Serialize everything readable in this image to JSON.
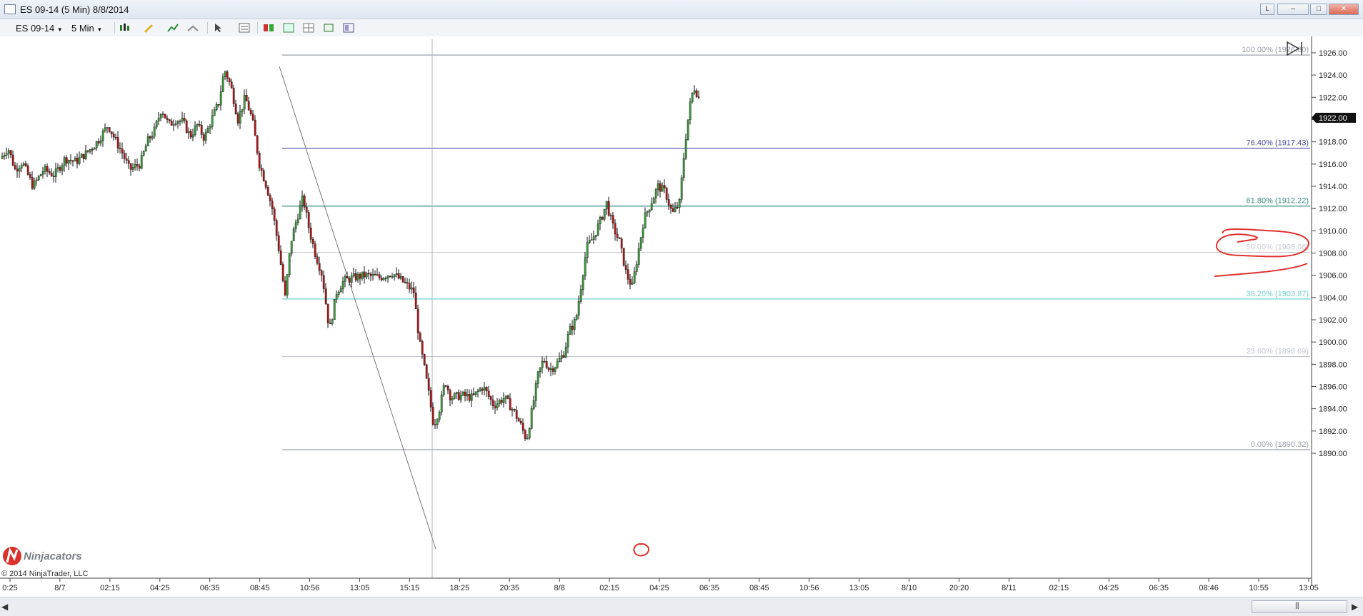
{
  "window": {
    "title": "ES 09-14 (5 Min)  8/8/2014",
    "btn_l": "L"
  },
  "toolbar": {
    "instrument": "ES 09-14",
    "interval": "5 Min"
  },
  "axis": {
    "y_labels": [
      "1926.00",
      "1924.00",
      "1922.00",
      "1920.00",
      "1918.00",
      "1916.00",
      "1914.00",
      "1912.00",
      "1910.00",
      "1908.00",
      "1906.00",
      "1904.00",
      "1902.00",
      "1900.00",
      "1898.00",
      "1896.00",
      "1894.00",
      "1892.00",
      "1890.00"
    ],
    "x_labels": [
      "0:25",
      "8/7",
      "02:15",
      "04:25",
      "06:35",
      "08:45",
      "10:56",
      "13:05",
      "15:15",
      "18:25",
      "20:35",
      "8/8",
      "02:15",
      "04:25",
      "06:35",
      "08:45",
      "10:56",
      "13:05",
      "8/10",
      "20:20",
      "8/11",
      "02:15",
      "04:25",
      "06:35",
      "08:46",
      "10:55",
      "13:05"
    ]
  },
  "fib_levels": [
    {
      "label": "100.00% (1926.80)",
      "price": 1925.8,
      "color": "#9aa0a8"
    },
    {
      "label": "76.40% (1917.43)",
      "price": 1917.43,
      "color": "#4c4c9e"
    },
    {
      "label": "61.80% (1912.22)",
      "price": 1912.22,
      "color": "#3a8a86"
    },
    {
      "label": "50.00% (1908.06)",
      "price": 1908.06,
      "color": "#c9ccd1"
    },
    {
      "label": "38.20% (1903.87)",
      "price": 1903.87,
      "color": "#6fd2cc"
    },
    {
      "label": "23.60% (1898.69)",
      "price": 1898.69,
      "color": "#c3c6cc"
    },
    {
      "label": "0.00% (1890.32)",
      "price": 1890.32,
      "color": "#9aa0a8"
    }
  ],
  "current_price": "1922.00",
  "branding": {
    "logo": "Ninjacators",
    "copyright": "© 2014 NinjaTrader, LLC"
  },
  "price_path": [
    [
      0,
      1916.5
    ],
    [
      10,
      1917.5
    ],
    [
      20,
      1915.5
    ],
    [
      30,
      1916.2
    ],
    [
      45,
      1914
    ],
    [
      60,
      1915.5
    ],
    [
      75,
      1915
    ],
    [
      90,
      1916.5
    ],
    [
      105,
      1916.2
    ],
    [
      120,
      1917
    ],
    [
      135,
      1918
    ],
    [
      150,
      1919.5
    ],
    [
      160,
      1918.2
    ],
    [
      170,
      1917
    ],
    [
      180,
      1915.5
    ],
    [
      195,
      1916
    ],
    [
      205,
      1918
    ],
    [
      215,
      1919
    ],
    [
      225,
      1921
    ],
    [
      235,
      1919.5
    ],
    [
      245,
      1920
    ],
    [
      255,
      1919.8
    ],
    [
      265,
      1918.5
    ],
    [
      275,
      1919.5
    ],
    [
      285,
      1918.3
    ],
    [
      295,
      1920
    ],
    [
      305,
      1921.5
    ],
    [
      313,
      1924.5
    ],
    [
      322,
      1923
    ],
    [
      332,
      1920
    ],
    [
      342,
      1922
    ],
    [
      352,
      1920
    ],
    [
      362,
      1916
    ],
    [
      372,
      1914
    ],
    [
      380,
      1912
    ],
    [
      390,
      1908
    ],
    [
      398,
      1904
    ],
    [
      406,
      1909
    ],
    [
      414,
      1911
    ],
    [
      423,
      1913
    ],
    [
      432,
      1910
    ],
    [
      440,
      1908
    ],
    [
      450,
      1906
    ],
    [
      460,
      1901
    ],
    [
      470,
      1904.5
    ],
    [
      480,
      1905.5
    ],
    [
      495,
      1905.8
    ],
    [
      510,
      1906
    ],
    [
      530,
      1905.8
    ],
    [
      548,
      1906.2
    ],
    [
      565,
      1905.3
    ],
    [
      578,
      1904.5
    ],
    [
      586,
      1900
    ],
    [
      592,
      1898
    ],
    [
      600,
      1895
    ],
    [
      606,
      1892.5
    ],
    [
      614,
      1894
    ],
    [
      622,
      1896.5
    ],
    [
      630,
      1895
    ],
    [
      645,
      1895.2
    ],
    [
      660,
      1895
    ],
    [
      675,
      1896
    ],
    [
      690,
      1894.3
    ],
    [
      705,
      1895
    ],
    [
      718,
      1893.8
    ],
    [
      728,
      1892.5
    ],
    [
      736,
      1891.2
    ],
    [
      744,
      1894
    ],
    [
      752,
      1897
    ],
    [
      760,
      1898.5
    ],
    [
      768,
      1897.5
    ],
    [
      778,
      1898
    ],
    [
      788,
      1899
    ],
    [
      796,
      1901
    ],
    [
      805,
      1902
    ],
    [
      812,
      1905
    ],
    [
      820,
      1908.5
    ],
    [
      830,
      1909.5
    ],
    [
      840,
      1911
    ],
    [
      848,
      1912.5
    ],
    [
      856,
      1910.5
    ],
    [
      866,
      1909
    ],
    [
      876,
      1906
    ],
    [
      884,
      1905
    ],
    [
      892,
      1908
    ],
    [
      900,
      1911
    ],
    [
      910,
      1912.5
    ],
    [
      920,
      1914
    ],
    [
      930,
      1913.5
    ],
    [
      940,
      1911.5
    ],
    [
      950,
      1912.5
    ],
    [
      958,
      1918
    ],
    [
      964,
      1921
    ],
    [
      970,
      1923
    ],
    [
      977,
      1922
    ]
  ]
}
